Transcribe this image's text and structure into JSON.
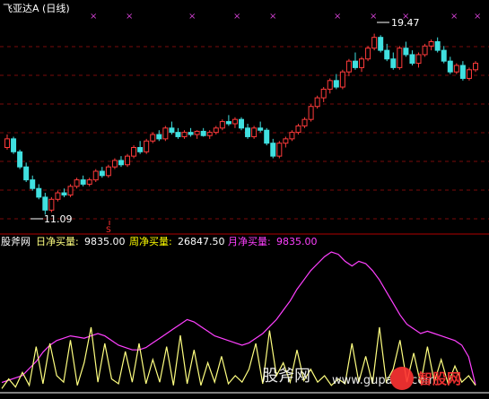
{
  "header": {
    "title": "飞亚达A (日线)"
  },
  "colors": {
    "background": "#000000",
    "grid": "#7a0a0a",
    "panel_divider": "#b00000",
    "candle_up": "#ff3b3b",
    "candle_down": "#40e0e0",
    "x_marker": "#d040d0",
    "s_marker": "#ff3030",
    "daily": "#ffff80",
    "weekly": "#ffff00",
    "monthly": "#ff40ff",
    "indicator_white": "#ffffff",
    "watermark_red": "#ff3333"
  },
  "price_panel": {
    "high_label": "19.47",
    "low_label": "11.09",
    "s_marker_label": "S",
    "x_marker_glyph": "×"
  },
  "indicator_panel": {
    "legend": [
      {
        "prefix": "股斧网",
        "label": "日净买量:",
        "value": "9835.00"
      },
      {
        "label": "周净买量:",
        "value": "26847.50"
      },
      {
        "label": "月净买量:",
        "value": "9835.00"
      }
    ]
  },
  "watermark": {
    "text_cn": "股斧网",
    "text_url": "www.gupang.com",
    "logo": "智股网"
  },
  "chart_data": {
    "type": "candlestick",
    "title": "飞亚达A (日线)",
    "xlabel": "",
    "ylabel": "",
    "ylim": [
      10.4,
      20.2
    ],
    "grid": true,
    "candles": [
      [
        14.2,
        14.8,
        14.1,
        14.6
      ],
      [
        14.6,
        14.7,
        13.9,
        14.0
      ],
      [
        14.0,
        14.1,
        13.2,
        13.3
      ],
      [
        13.3,
        13.5,
        12.6,
        12.7
      ],
      [
        12.7,
        12.9,
        12.2,
        12.3
      ],
      [
        12.3,
        12.5,
        11.8,
        11.9
      ],
      [
        11.9,
        12.1,
        11.09,
        11.3
      ],
      [
        11.3,
        11.9,
        11.2,
        11.8
      ],
      [
        11.8,
        12.2,
        11.7,
        12.1
      ],
      [
        12.1,
        12.3,
        11.9,
        12.0
      ],
      [
        12.0,
        12.5,
        11.9,
        12.4
      ],
      [
        12.4,
        12.8,
        12.3,
        12.7
      ],
      [
        12.7,
        12.9,
        12.4,
        12.5
      ],
      [
        12.5,
        12.8,
        12.4,
        12.7
      ],
      [
        12.7,
        13.2,
        12.6,
        13.1
      ],
      [
        13.1,
        13.3,
        12.8,
        12.9
      ],
      [
        12.9,
        13.4,
        12.8,
        13.3
      ],
      [
        13.3,
        13.7,
        13.2,
        13.6
      ],
      [
        13.6,
        13.8,
        13.3,
        13.4
      ],
      [
        13.4,
        13.9,
        13.3,
        13.8
      ],
      [
        13.8,
        14.3,
        13.7,
        14.2
      ],
      [
        14.2,
        14.5,
        13.9,
        14.0
      ],
      [
        14.0,
        14.6,
        13.9,
        14.5
      ],
      [
        14.5,
        14.9,
        14.4,
        14.8
      ],
      [
        14.8,
        15.0,
        14.5,
        14.6
      ],
      [
        14.6,
        15.2,
        14.5,
        15.1
      ],
      [
        15.1,
        15.4,
        14.8,
        14.9
      ],
      [
        14.9,
        15.1,
        14.6,
        14.7
      ],
      [
        14.7,
        15.0,
        14.6,
        14.9
      ],
      [
        14.9,
        15.1,
        14.7,
        14.8
      ],
      [
        14.8,
        15.0,
        14.6,
        14.95
      ],
      [
        14.95,
        15.1,
        14.7,
        14.75
      ],
      [
        14.75,
        15.0,
        14.6,
        14.9
      ],
      [
        14.9,
        15.2,
        14.8,
        15.1
      ],
      [
        15.1,
        15.5,
        15.0,
        15.4
      ],
      [
        15.4,
        15.7,
        15.2,
        15.3
      ],
      [
        15.3,
        15.6,
        15.1,
        15.5
      ],
      [
        15.5,
        15.6,
        15.0,
        15.1
      ],
      [
        15.1,
        15.3,
        14.6,
        14.7
      ],
      [
        14.7,
        15.2,
        14.6,
        15.1
      ],
      [
        15.1,
        15.4,
        14.9,
        15.0
      ],
      [
        15.0,
        15.1,
        14.3,
        14.4
      ],
      [
        14.4,
        14.6,
        13.7,
        13.8
      ],
      [
        13.8,
        14.5,
        13.7,
        14.4
      ],
      [
        14.4,
        14.7,
        14.2,
        14.6
      ],
      [
        14.6,
        15.0,
        14.5,
        14.9
      ],
      [
        14.9,
        15.3,
        14.8,
        15.2
      ],
      [
        15.2,
        15.6,
        15.1,
        15.5
      ],
      [
        15.5,
        16.2,
        15.4,
        16.1
      ],
      [
        16.1,
        16.6,
        16.0,
        16.5
      ],
      [
        16.5,
        17.0,
        16.3,
        16.9
      ],
      [
        16.9,
        17.4,
        16.7,
        17.3
      ],
      [
        17.3,
        17.6,
        16.9,
        17.0
      ],
      [
        17.0,
        17.8,
        16.9,
        17.7
      ],
      [
        17.7,
        18.3,
        17.5,
        18.2
      ],
      [
        18.2,
        18.6,
        17.8,
        17.9
      ],
      [
        17.9,
        18.4,
        17.7,
        18.3
      ],
      [
        18.3,
        18.9,
        18.2,
        18.8
      ],
      [
        18.8,
        19.47,
        18.7,
        19.3
      ],
      [
        19.3,
        19.4,
        18.6,
        18.7
      ],
      [
        18.7,
        19.0,
        18.2,
        18.3
      ],
      [
        18.3,
        18.6,
        17.8,
        17.9
      ],
      [
        17.9,
        18.9,
        17.8,
        18.8
      ],
      [
        18.8,
        19.1,
        18.4,
        18.5
      ],
      [
        18.5,
        18.7,
        18.0,
        18.1
      ],
      [
        18.1,
        18.6,
        17.9,
        18.5
      ],
      [
        18.5,
        19.0,
        18.4,
        18.9
      ],
      [
        18.9,
        19.2,
        18.7,
        19.1
      ],
      [
        19.1,
        19.3,
        18.6,
        18.7
      ],
      [
        18.7,
        18.9,
        18.1,
        18.2
      ],
      [
        18.2,
        18.4,
        17.6,
        17.7
      ],
      [
        17.7,
        18.1,
        17.6,
        18.0
      ],
      [
        18.0,
        18.2,
        17.3,
        17.4
      ],
      [
        17.4,
        17.9,
        17.3,
        17.8
      ],
      [
        17.8,
        18.2,
        17.7,
        18.1
      ]
    ],
    "series": [
      {
        "name": "日净买量",
        "values": [
          2,
          8,
          3,
          12,
          4,
          28,
          5,
          30,
          10,
          6,
          32,
          4,
          18,
          40,
          6,
          30,
          8,
          5,
          25,
          6,
          30,
          5,
          20,
          6,
          28,
          4,
          35,
          5,
          26,
          4,
          18,
          6,
          22,
          5,
          10,
          6,
          14,
          30,
          5,
          38,
          10,
          18,
          6,
          26,
          7,
          14,
          6,
          10,
          4,
          8,
          5,
          30,
          6,
          22,
          5,
          40,
          6,
          14,
          32,
          6,
          24,
          5,
          28,
          6,
          20,
          5,
          16,
          6,
          10,
          4
        ]
      },
      {
        "name": "周净买量",
        "values": [
          8,
          10,
          12,
          14,
          20,
          26,
          34,
          40,
          44,
          46,
          48,
          47,
          46,
          48,
          50,
          48,
          44,
          40,
          38,
          36,
          36,
          38,
          42,
          46,
          50,
          54,
          58,
          62,
          60,
          56,
          52,
          48,
          46,
          44,
          42,
          40,
          42,
          46,
          50,
          56,
          62,
          70,
          78,
          88,
          96,
          104,
          110,
          116,
          120,
          118,
          112,
          108,
          112,
          110,
          104,
          96,
          86,
          76,
          66,
          58,
          54,
          50,
          52,
          50,
          48,
          46,
          44,
          40,
          30,
          6
        ]
      }
    ]
  }
}
